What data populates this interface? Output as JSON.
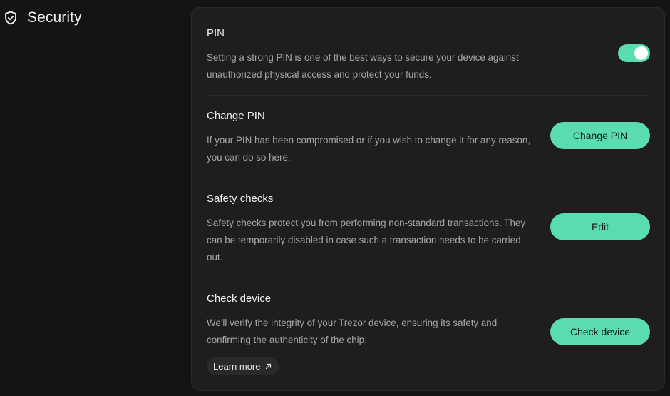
{
  "header": {
    "title": "Security",
    "icon": "shield-check-icon"
  },
  "settings": {
    "pin": {
      "title": "PIN",
      "description": "Setting a strong PIN is one of the best ways to secure your device against unauthorized physical access and protect your funds.",
      "toggle_enabled": true
    },
    "change_pin": {
      "title": "Change PIN",
      "description": "If your PIN has been compromised or if you wish to change it for any reason, you can do so here.",
      "button_label": "Change PIN"
    },
    "safety_checks": {
      "title": "Safety checks",
      "description": "Safety checks protect you from performing non-standard transactions. They can be temporarily disabled in case such a transaction needs to be carried out.",
      "button_label": "Edit"
    },
    "check_device": {
      "title": "Check device",
      "description": "We'll verify the integrity of your Trezor device, ensuring its safety and confirming the authenticity of the chip.",
      "button_label": "Check device",
      "learn_more_label": "Learn more",
      "learn_more_icon": "external-link-arrow-icon"
    }
  },
  "colors": {
    "accent": "#5bdcb0",
    "background": "#141414",
    "card": "#1e1e1e",
    "text_muted": "#a7a7a7"
  }
}
